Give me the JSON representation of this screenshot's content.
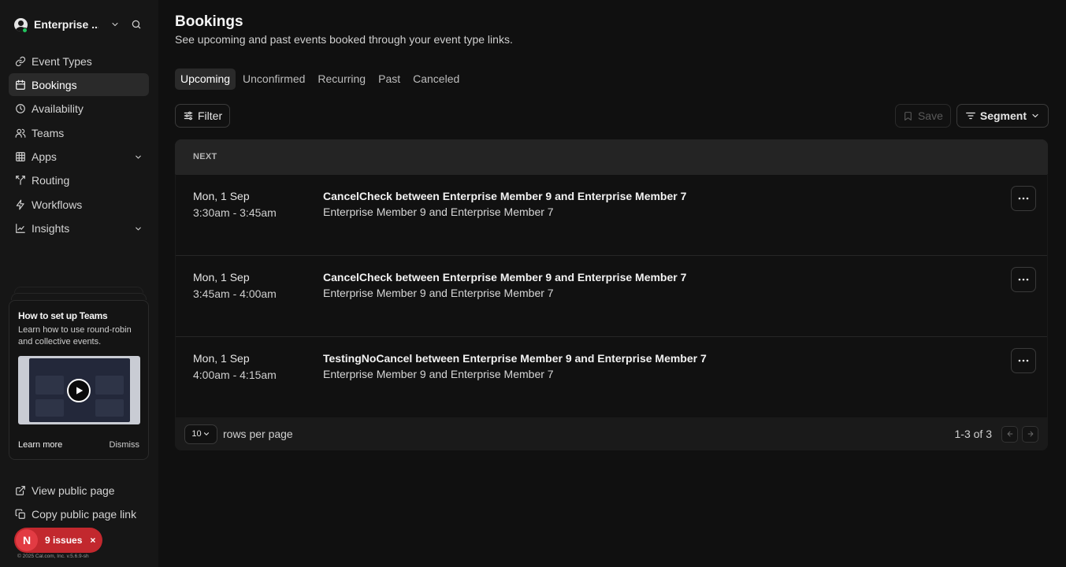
{
  "sidebar": {
    "org_name": "Enterprise ...",
    "nav": [
      {
        "label": "Event Types",
        "icon": "link-icon",
        "active": false
      },
      {
        "label": "Bookings",
        "icon": "calendar-icon",
        "active": true
      },
      {
        "label": "Availability",
        "icon": "clock-icon",
        "active": false
      },
      {
        "label": "Teams",
        "icon": "users-icon",
        "active": false
      },
      {
        "label": "Apps",
        "icon": "grid-icon",
        "active": false,
        "has_chevron": true
      },
      {
        "label": "Routing",
        "icon": "split-icon",
        "active": false
      },
      {
        "label": "Workflows",
        "icon": "zap-icon",
        "active": false
      },
      {
        "label": "Insights",
        "icon": "chart-icon",
        "active": false,
        "has_chevron": true
      }
    ],
    "promo": {
      "title": "How to set up Teams",
      "description": "Learn how to use round-robin and collective events.",
      "learn_more": "Learn more",
      "dismiss": "Dismiss"
    },
    "bottom_links": [
      {
        "label": "View public page",
        "icon": "external-link-icon"
      },
      {
        "label": "Copy public page link",
        "icon": "copy-icon"
      }
    ],
    "issues": {
      "badge": "N",
      "label": "9 issues",
      "close": "×"
    },
    "copyright": "© 2025 Cal.com, Inc. v.5.6.9-sh"
  },
  "main": {
    "title": "Bookings",
    "subtitle": "See upcoming and past events booked through your event type links.",
    "tabs": [
      {
        "label": "Upcoming",
        "active": true
      },
      {
        "label": "Unconfirmed",
        "active": false
      },
      {
        "label": "Recurring",
        "active": false
      },
      {
        "label": "Past",
        "active": false
      },
      {
        "label": "Canceled",
        "active": false
      }
    ],
    "toolbar": {
      "filter_label": "Filter",
      "save_label": "Save",
      "segment_label": "Segment"
    },
    "table": {
      "section_header": "NEXT",
      "rows": [
        {
          "date": "Mon, 1 Sep",
          "time": "3:30am - 3:45am",
          "title": "CancelCheck between Enterprise Member 9 and Enterprise Member 7",
          "attendees": "Enterprise Member 9 and Enterprise Member 7"
        },
        {
          "date": "Mon, 1 Sep",
          "time": "3:45am - 4:00am",
          "title": "CancelCheck between Enterprise Member 9 and Enterprise Member 7",
          "attendees": "Enterprise Member 9 and Enterprise Member 7"
        },
        {
          "date": "Mon, 1 Sep",
          "time": "4:00am - 4:15am",
          "title": "TestingNoCancel between Enterprise Member 9 and Enterprise Member 7",
          "attendees": "Enterprise Member 9 and Enterprise Member 7"
        }
      ],
      "rows_per_page": "10",
      "rows_per_page_label": "rows per page",
      "range": "1-3 of 3"
    }
  },
  "colors": {
    "background": "#101010",
    "sidebar": "#161616",
    "active_nav": "#2a2a2a",
    "issues_badge": "#c2282e",
    "online": "#22c55e"
  }
}
